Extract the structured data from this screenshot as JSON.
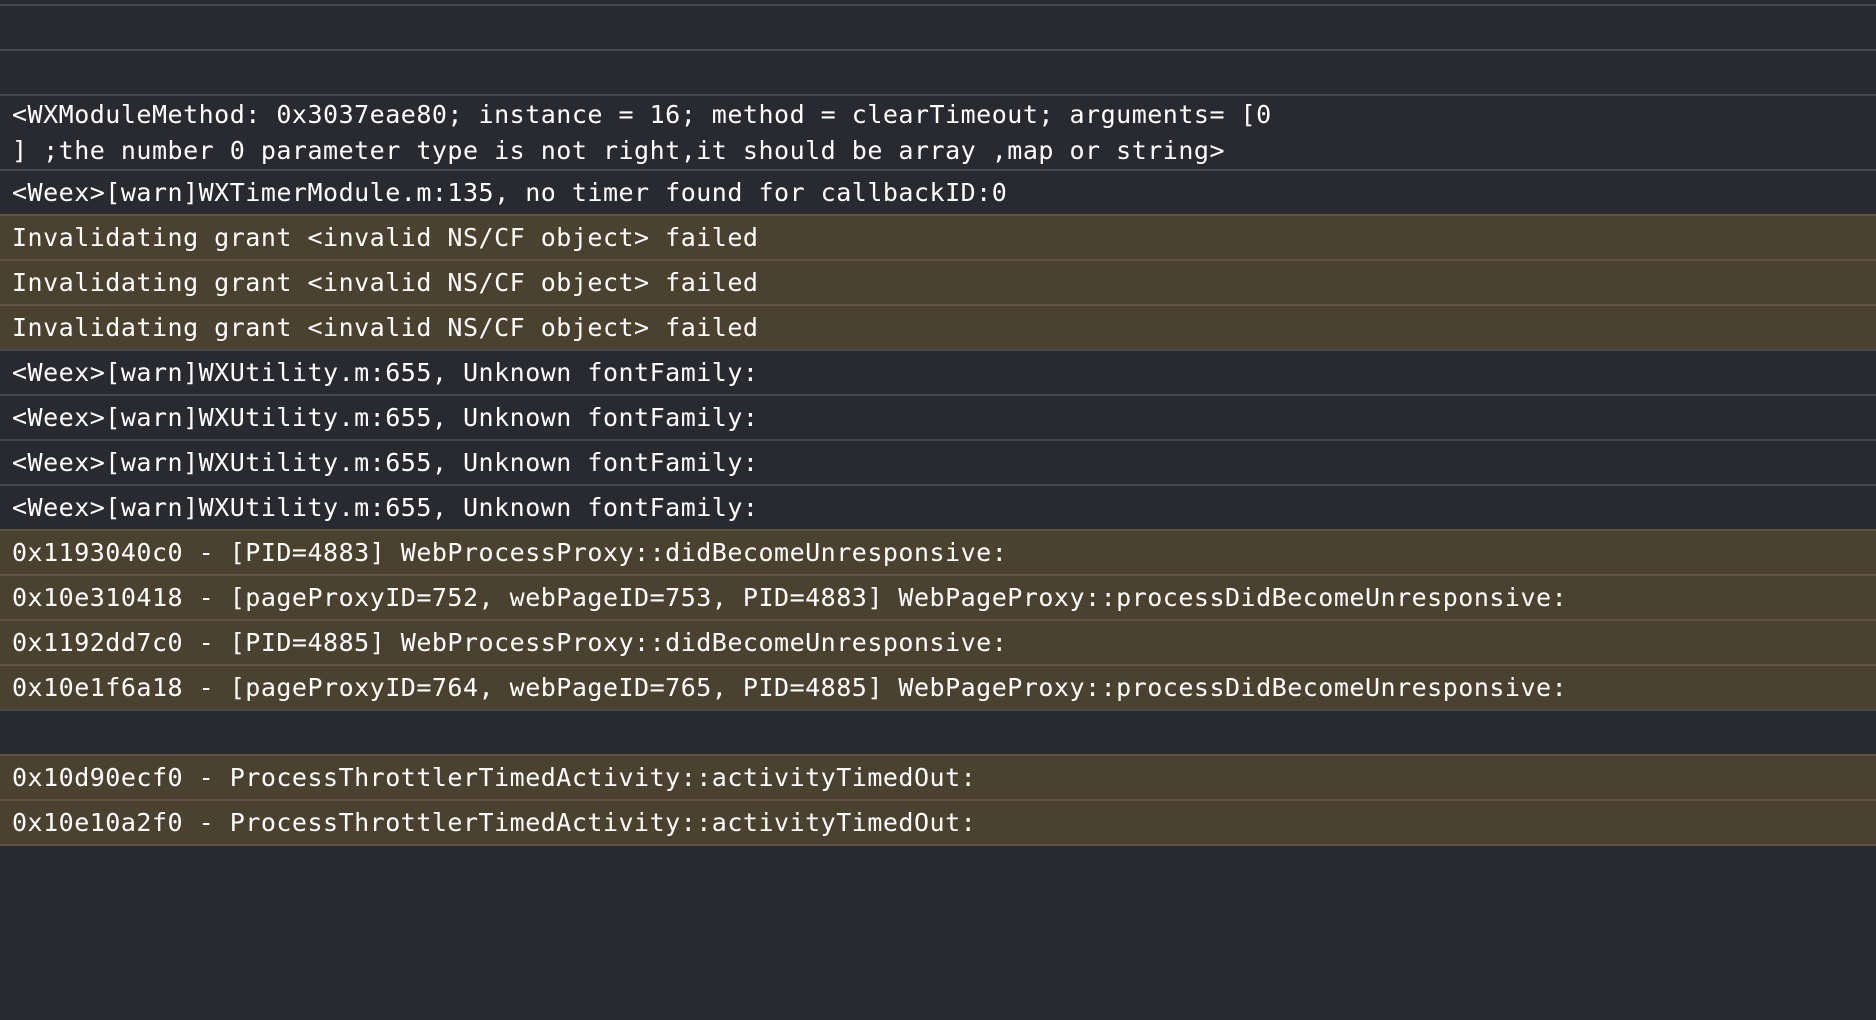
{
  "console": {
    "rows": [
      {
        "kind": "normal",
        "lines": [
          ""
        ]
      },
      {
        "kind": "normal",
        "lines": [
          ""
        ]
      },
      {
        "kind": "normal",
        "lines": [
          "<WXModuleMethod: 0x3037eae80; instance = 16; method = clearTimeout; arguments= [0",
          "] ;the number 0 parameter type is not right,it should be array ,map or string>"
        ]
      },
      {
        "kind": "normal",
        "lines": [
          "<Weex>[warn]WXTimerModule.m:135, no timer found for callbackID:0"
        ]
      },
      {
        "kind": "warning",
        "lines": [
          "Invalidating grant <invalid NS/CF object> failed"
        ]
      },
      {
        "kind": "warning",
        "lines": [
          "Invalidating grant <invalid NS/CF object> failed"
        ]
      },
      {
        "kind": "warning",
        "lines": [
          "Invalidating grant <invalid NS/CF object> failed"
        ]
      },
      {
        "kind": "normal",
        "lines": [
          "<Weex>[warn]WXUtility.m:655, Unknown fontFamily:"
        ]
      },
      {
        "kind": "normal",
        "lines": [
          "<Weex>[warn]WXUtility.m:655, Unknown fontFamily:"
        ]
      },
      {
        "kind": "normal",
        "lines": [
          "<Weex>[warn]WXUtility.m:655, Unknown fontFamily:"
        ]
      },
      {
        "kind": "normal",
        "lines": [
          "<Weex>[warn]WXUtility.m:655, Unknown fontFamily:"
        ]
      },
      {
        "kind": "warning",
        "lines": [
          "0x1193040c0 - [PID=4883] WebProcessProxy::didBecomeUnresponsive:"
        ]
      },
      {
        "kind": "warning",
        "lines": [
          "0x10e310418 - [pageProxyID=752, webPageID=753, PID=4883] WebPageProxy::processDidBecomeUnresponsive:"
        ]
      },
      {
        "kind": "warning",
        "lines": [
          "0x1192dd7c0 - [PID=4885] WebProcessProxy::didBecomeUnresponsive:"
        ]
      },
      {
        "kind": "warning",
        "lines": [
          "0x10e1f6a18 - [pageProxyID=764, webPageID=765, PID=4885] WebPageProxy::processDidBecomeUnresponsive:"
        ]
      },
      {
        "kind": "normal",
        "lines": [
          ""
        ]
      },
      {
        "kind": "warning",
        "lines": [
          "0x10d90ecf0 - ProcessThrottlerTimedActivity::activityTimedOut:"
        ]
      },
      {
        "kind": "warning",
        "lines": [
          "0x10e10a2f0 - ProcessThrottlerTimedActivity::activityTimedOut:"
        ]
      }
    ]
  }
}
